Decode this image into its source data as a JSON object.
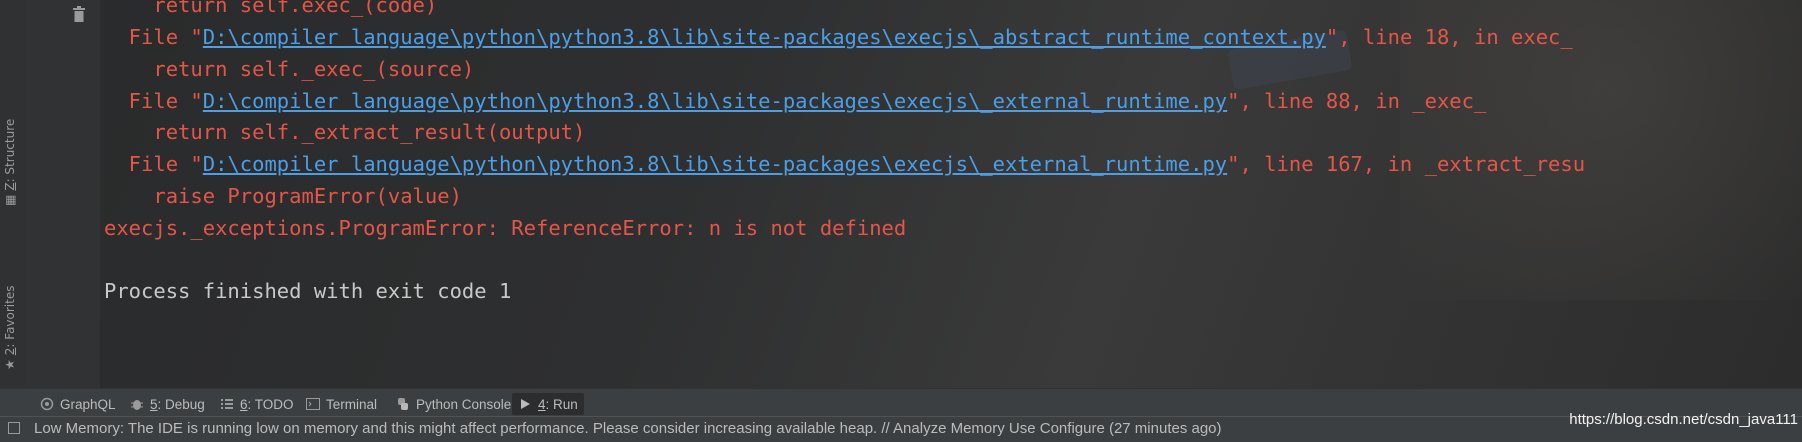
{
  "left_strip": {
    "structure_label": "Z: Structure",
    "structure_key": "Z",
    "structure_rest": ": Structure",
    "favorites_key": "2",
    "favorites_rest": ": Favorites"
  },
  "console": {
    "lines": [
      {
        "indent": "    ",
        "text": "return self.exec_(code)",
        "style": "err"
      },
      {
        "indent": "  ",
        "prefix": "File \"",
        "link": "D:\\compiler language\\python\\python3.8\\lib\\site-packages\\execjs\\_abstract_runtime_context.py",
        "suffix": "\", line 18, in exec_",
        "style": "err"
      },
      {
        "indent": "    ",
        "text": "return self._exec_(source)",
        "style": "err"
      },
      {
        "indent": "  ",
        "prefix": "File \"",
        "link": "D:\\compiler language\\python\\python3.8\\lib\\site-packages\\execjs\\_external_runtime.py",
        "suffix": "\", line 88, in _exec_",
        "style": "err"
      },
      {
        "indent": "    ",
        "text": "return self._extract_result(output)",
        "style": "err"
      },
      {
        "indent": "  ",
        "prefix": "File \"",
        "link": "D:\\compiler language\\python\\python3.8\\lib\\site-packages\\execjs\\_external_runtime.py",
        "suffix": "\", line 167, in _extract_resu",
        "style": "err"
      },
      {
        "indent": "    ",
        "text": "raise ProgramError(value)",
        "style": "err"
      },
      {
        "indent": "",
        "text": "execjs._exceptions.ProgramError: ReferenceError: n is not defined",
        "style": "err"
      },
      {
        "indent": "",
        "text": "",
        "style": "normal"
      },
      {
        "indent": "",
        "text": "Process finished with exit code 1",
        "style": "normal"
      }
    ]
  },
  "tabs": [
    {
      "key": "",
      "rest": "GraphQL",
      "icon": "graphql-icon",
      "active": false
    },
    {
      "key": "5",
      "rest": ": Debug",
      "icon": "bug-icon",
      "active": false
    },
    {
      "key": "6",
      "rest": ": TODO",
      "icon": "list-icon",
      "active": false
    },
    {
      "key": "",
      "rest": "Terminal",
      "icon": "terminal-icon",
      "active": false
    },
    {
      "key": "",
      "rest": "Python Console",
      "icon": "python-icon",
      "active": false
    },
    {
      "key": "4",
      "rest": ": Run",
      "icon": "play-icon",
      "active": true
    }
  ],
  "status": {
    "message": "Low Memory: The IDE is running low on memory and this might affect performance. Please consider increasing available heap. // Analyze Memory Use   Configure (27 minutes ago)"
  },
  "watermark": "https://blog.csdn.net/csdn_java111",
  "colors": {
    "error_text": "#e3564a",
    "link_text": "#4c9ee6",
    "normal_text": "#c9c9c9",
    "panel_bg": "#3c3f41"
  }
}
